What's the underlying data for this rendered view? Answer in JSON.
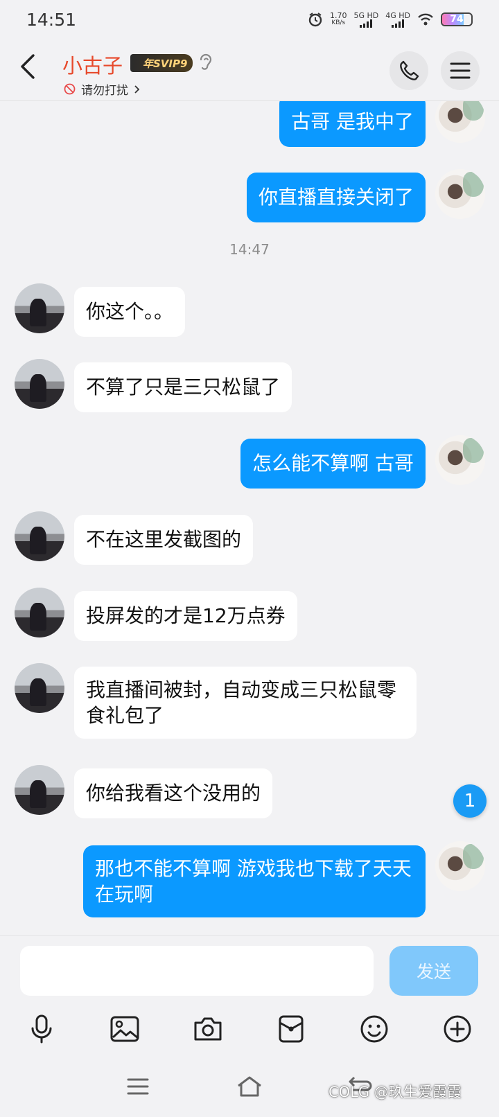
{
  "status_bar": {
    "time": "14:51",
    "speed_value": "1.70",
    "speed_unit": "KB/s",
    "net1": "5G HD",
    "net2": "4G HD",
    "battery": "74",
    "icons": [
      "alarm-icon",
      "signal-icon",
      "wifi-icon",
      "battery-icon"
    ]
  },
  "header": {
    "contact_name": "小古子",
    "vip_badge": "年SVIP9",
    "dnd_label": "请勿打扰",
    "colors": {
      "name": "#e7492b"
    }
  },
  "messages": [
    {
      "side": "out",
      "text": "古哥 是我中了"
    },
    {
      "side": "out",
      "text": "你直播直接关闭了"
    },
    {
      "side": "in",
      "text": "你这个。。"
    },
    {
      "side": "in",
      "text": "不算了只是三只松鼠了"
    },
    {
      "side": "out",
      "text": "怎么能不算啊 古哥"
    },
    {
      "side": "in",
      "text": "不在这里发截图的"
    },
    {
      "side": "in",
      "text": "投屏发的才是12万点券"
    },
    {
      "side": "in",
      "text": "我直播间被封，自动变成三只松鼠零食礼包了"
    },
    {
      "side": "in",
      "text": "你给我看这个没用的"
    },
    {
      "side": "out",
      "text": "那也不能不算啊 游戏我也下载了天天在玩啊"
    }
  ],
  "timestamp": "14:47",
  "unread_count": "1",
  "input": {
    "value": "",
    "send_label": "发送"
  },
  "toolbar": [
    "mic-icon",
    "image-icon",
    "camera-icon",
    "red-packet-icon",
    "emoji-icon",
    "plus-icon"
  ],
  "watermark": "COLG @玖生爱霞霞",
  "colors": {
    "outgoing_bubble": "#0b99ff",
    "incoming_bubble": "#ffffff",
    "send_button": "#80c8fb"
  }
}
